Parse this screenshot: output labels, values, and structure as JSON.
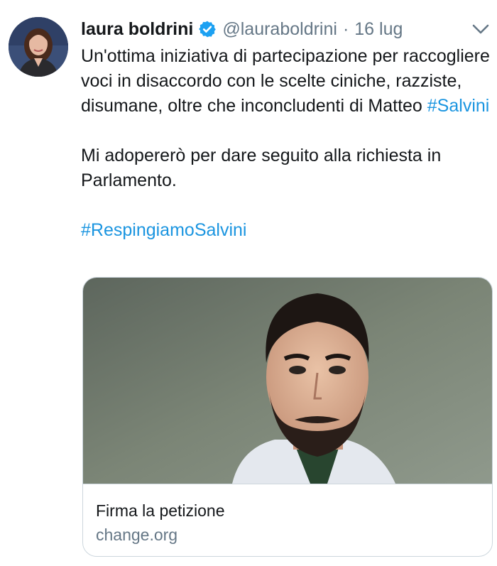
{
  "tweet": {
    "author": {
      "name": "laura boldrini",
      "handle": "@lauraboldrini",
      "verified": true
    },
    "separator": "·",
    "date": "16 lug",
    "text": {
      "p1_before": "Un'ottima iniziativa di partecipazione per raccogliere voci in disaccordo con le scelte ciniche, razziste, disumane, oltre che inconcludenti di Matteo ",
      "p1_hashtag": "#Salvini",
      "p2": "Mi adopererò per dare seguito alla richiesta in Parlamento.",
      "p3_hashtag": "#RespingiamoSalvini"
    },
    "card": {
      "title": "Firma la petizione",
      "domain": "change.org"
    }
  },
  "colors": {
    "link": "#1b95e0",
    "secondary_text": "#657786",
    "primary_text": "#14171a",
    "border": "#ccd6dd",
    "verified_badge": "#1da1f2"
  },
  "icons": [
    "verified-badge-icon",
    "chevron-down-icon"
  ]
}
